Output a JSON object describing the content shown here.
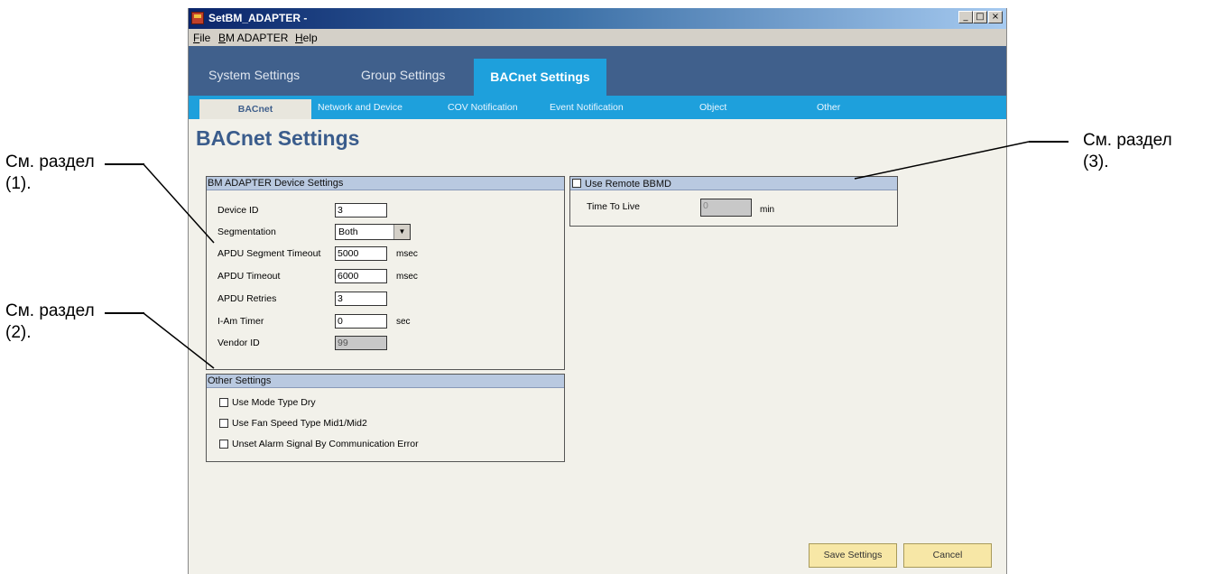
{
  "window": {
    "title": "SetBM_ADAPTER -",
    "controls": {
      "minimize": "_",
      "maximize": "□",
      "close": "×"
    }
  },
  "menu": [
    {
      "label": "File",
      "mnemonic": "F",
      "rest": "ile"
    },
    {
      "label": "BM ADAPTER",
      "mnemonic": "B",
      "rest": "M ADAPTER"
    },
    {
      "label": "Help",
      "mnemonic": "H",
      "rest": "elp"
    }
  ],
  "main_tabs": [
    {
      "label": "System Settings"
    },
    {
      "label": "Group Settings"
    },
    {
      "label": "BACnet Settings",
      "active": true
    }
  ],
  "sub_tabs": [
    {
      "label": "BACnet",
      "active": true
    },
    {
      "label": "Network and Device"
    },
    {
      "label": "COV Notification"
    },
    {
      "label": "Event Notification"
    },
    {
      "label": "Object"
    },
    {
      "label": "Other"
    }
  ],
  "page_title": "BACnet Settings",
  "device_settings": {
    "title": "BM ADAPTER Device Settings",
    "fields": [
      {
        "label": "Device ID",
        "value": "3",
        "unit": ""
      },
      {
        "label": "Segmentation",
        "value": "Both",
        "unit": ""
      },
      {
        "label": "APDU Segment Timeout",
        "value": "5000",
        "unit": "msec"
      },
      {
        "label": "APDU Timeout",
        "value": "6000",
        "unit": "msec"
      },
      {
        "label": "APDU Retries",
        "value": "3",
        "unit": ""
      },
      {
        "label": "I-Am Timer",
        "value": "0",
        "unit": "sec"
      },
      {
        "label": "Vendor ID",
        "value": "99",
        "unit": ""
      }
    ]
  },
  "other_settings": {
    "title": "Other Settings",
    "options": [
      {
        "label": "Use Mode Type Dry",
        "checked": false
      },
      {
        "label": "Use Fan Speed Type Mid1/Mid2",
        "checked": false
      },
      {
        "label": "Unset Alarm Signal By Communication Error",
        "checked": false
      }
    ]
  },
  "remote_bbmd": {
    "title": "Use Remote BBMD",
    "checked": false,
    "time_to_live_label": "Time To Live",
    "time_to_live_value": "0",
    "time_to_live_unit": "min"
  },
  "buttons": {
    "save": "Save Settings",
    "cancel": "Cancel"
  },
  "annotations": [
    {
      "line1": "См. раздел",
      "line2": "(1)."
    },
    {
      "line1": "См. раздел",
      "line2": "(2)."
    },
    {
      "line1": "См. раздел",
      "line2": "(3)."
    }
  ],
  "colors": {
    "tab_band": "#40608c",
    "subtab_band": "#1ea0dc",
    "group_header": "#b9c9e0",
    "button_fill": "#f7e7a6"
  }
}
